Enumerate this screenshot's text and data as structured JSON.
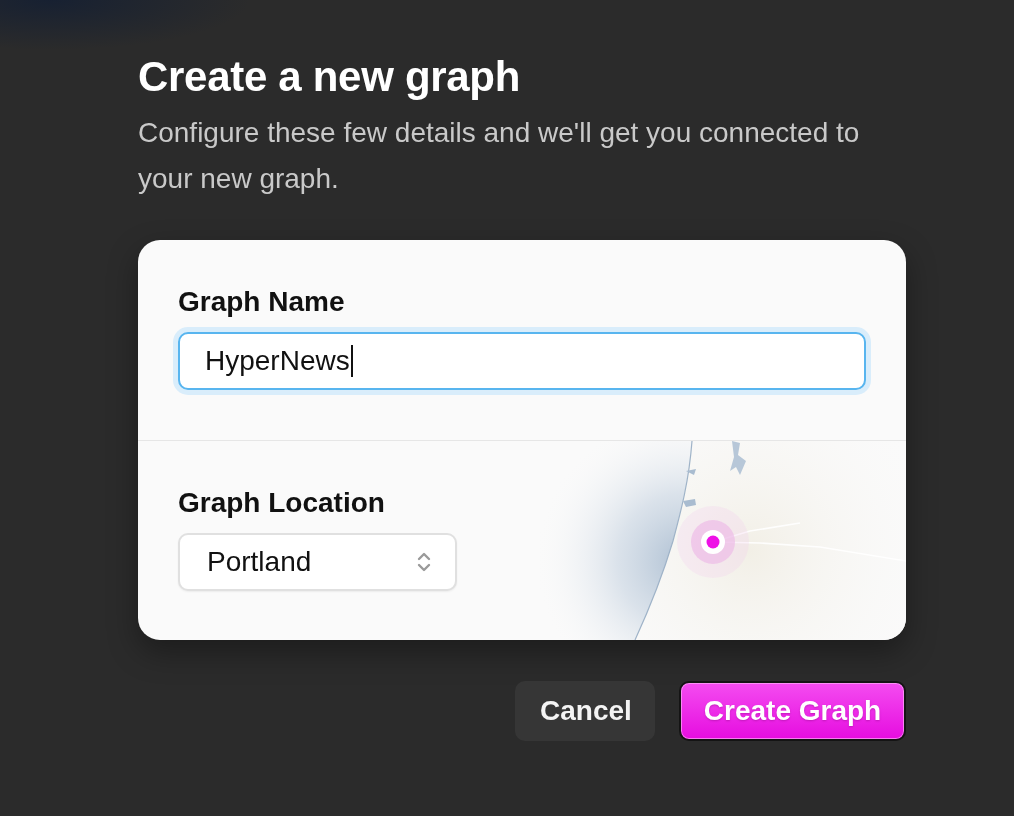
{
  "dialog": {
    "title": "Create a new graph",
    "description": "Configure these few details and we'll get you connected to your new graph."
  },
  "form": {
    "name_field": {
      "label": "Graph Name",
      "value": "HyperNews",
      "focused": true
    },
    "location_field": {
      "label": "Graph Location",
      "value": "Portland"
    }
  },
  "buttons": [
    {
      "label": "Cancel",
      "kind": "secondary"
    },
    {
      "label": "Create Graph",
      "kind": "primary"
    }
  ]
}
